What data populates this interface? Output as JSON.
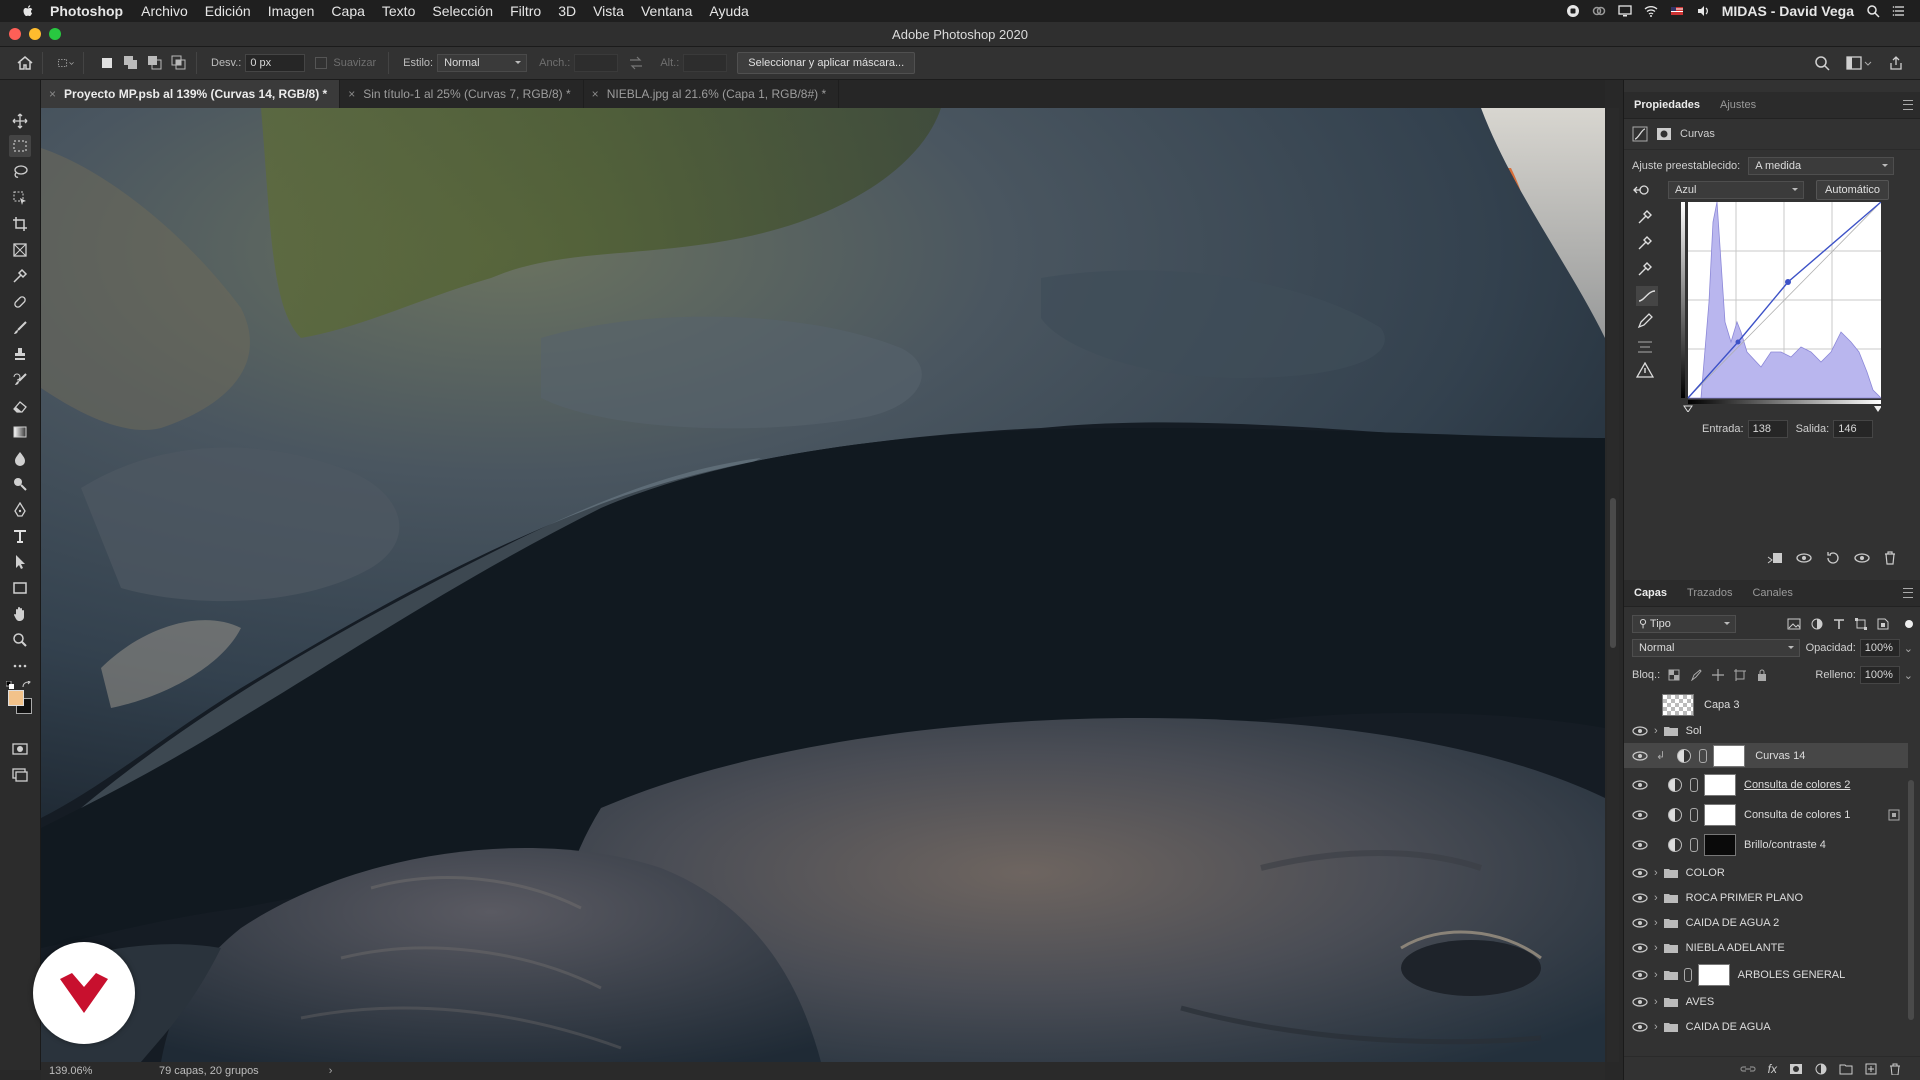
{
  "menubar": {
    "app_name": "Photoshop",
    "items": [
      "Archivo",
      "Edición",
      "Imagen",
      "Capa",
      "Texto",
      "Selección",
      "Filtro",
      "3D",
      "Vista",
      "Ventana",
      "Ayuda"
    ],
    "user": "MIDAS - David Vega"
  },
  "window": {
    "title": "Adobe Photoshop 2020"
  },
  "options": {
    "feather_label": "Desv.:",
    "feather_value": "0 px",
    "antialias_label": "Suavizar",
    "style_label": "Estilo:",
    "style_value": "Normal",
    "width_label": "Anch.:",
    "height_label": "Alt.:",
    "mask_button": "Seleccionar y aplicar máscara..."
  },
  "tabs": [
    {
      "label": "Proyecto MP.psb al 139% (Curvas 14, RGB/8) *"
    },
    {
      "label": "Sin título-1 al 25% (Curvas 7, RGB/8) *"
    },
    {
      "label": "NIEBLA.jpg al 21.6% (Capa 1, RGB/8#) *"
    }
  ],
  "status": {
    "zoom": "139.06%",
    "info": "79 capas, 20 grupos"
  },
  "properties": {
    "tabs": [
      "Propiedades",
      "Ajustes"
    ],
    "panel_title": "Curvas",
    "preset_label": "Ajuste preestablecido:",
    "preset_value": "A medida",
    "channel_value": "Azul",
    "auto_button": "Automático",
    "input_label": "Entrada:",
    "input_value": "138",
    "output_label": "Salida:",
    "output_value": "146"
  },
  "layers": {
    "tabs": [
      "Capas",
      "Trazados",
      "Canales"
    ],
    "filter_value": "Tipo",
    "blend_value": "Normal",
    "opacity_label": "Opacidad:",
    "opacity_value": "100%",
    "lock_label": "Bloq.:",
    "fill_label": "Relleno:",
    "fill_value": "100%",
    "items": [
      {
        "name": "Capa 3"
      },
      {
        "name": "Sol"
      },
      {
        "name": "Curvas 14"
      },
      {
        "name": "Consulta de colores 2"
      },
      {
        "name": "Consulta de colores 1"
      },
      {
        "name": "Brillo/contraste 4"
      },
      {
        "name": "COLOR"
      },
      {
        "name": "ROCA PRIMER PLANO"
      },
      {
        "name": "CAIDA DE AGUA 2"
      },
      {
        "name": "NIEBLA ADELANTE"
      },
      {
        "name": "ARBOLES GENERAL"
      },
      {
        "name": "AVES"
      },
      {
        "name": "CAIDA DE AGUA"
      }
    ]
  },
  "colors": {
    "accent_logo": "#c8102e",
    "foreground_swatch": "#f2c28a",
    "curve_line": "#3d52c7"
  }
}
